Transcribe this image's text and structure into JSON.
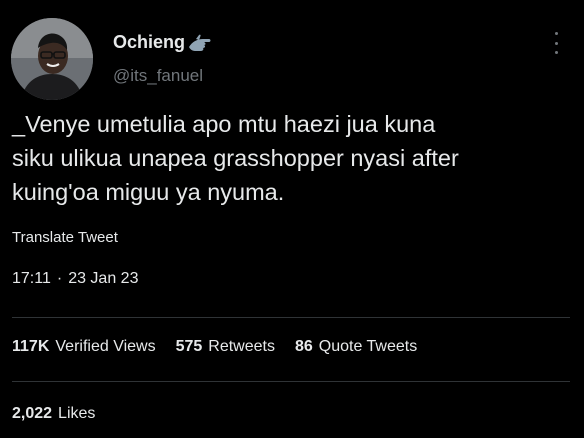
{
  "author": {
    "display_name": "Ochieng",
    "handle": "@its_fanuel",
    "name_emoji_icon": "hand-gesture-icon"
  },
  "tweet": {
    "text_lines": [
      "_Venye umetulia apo mtu haezi jua kuna",
      "siku ulikua unapea grasshopper nyasi after",
      "kuing'oa miguu ya nyuma."
    ],
    "translate_label": "Translate Tweet",
    "time": "17:11",
    "separator": "·",
    "date": "23 Jan 23"
  },
  "stats": {
    "views_count": "117K",
    "views_label": "Verified Views",
    "retweets_count": "575",
    "retweets_label": "Retweets",
    "quotes_count": "86",
    "quotes_label": "Quote Tweets",
    "likes_count": "2,022",
    "likes_label": "Likes"
  },
  "icons": {
    "more": "more-options-icon"
  },
  "colors": {
    "background": "#000000",
    "text": "#e7e9ea",
    "secondary": "#71767b",
    "divider": "#2f3336"
  }
}
